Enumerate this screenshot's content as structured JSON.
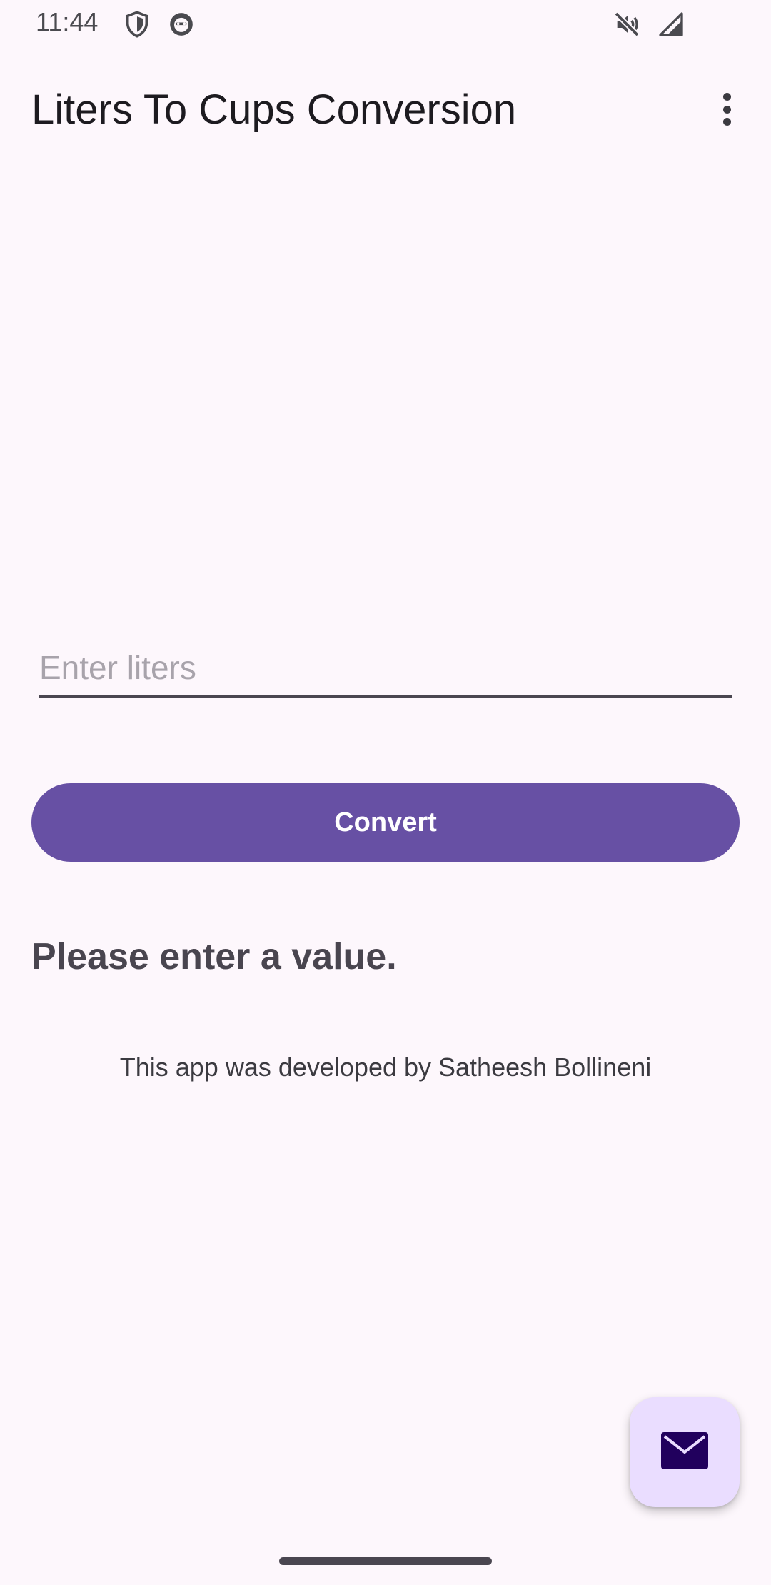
{
  "status_bar": {
    "time": "11:44",
    "left_icons": [
      "shield-icon",
      "cat-face-icon"
    ],
    "right_icons": [
      "mute-icon",
      "signal-icon"
    ]
  },
  "app_bar": {
    "title": "Liters To Cups Conversion",
    "menu_icon": "more-vert-icon"
  },
  "form": {
    "input_placeholder": "Enter liters",
    "input_value": "",
    "convert_label": "Convert"
  },
  "result": {
    "message": "Please enter a value."
  },
  "footer": {
    "credit": "This app was developed by Satheesh Bollineni"
  },
  "fab": {
    "icon": "mail-icon"
  },
  "colors": {
    "background": "#fdf7fc",
    "primary": "#6750a4",
    "fab_container": "#eaddff",
    "fab_icon": "#21005d"
  }
}
